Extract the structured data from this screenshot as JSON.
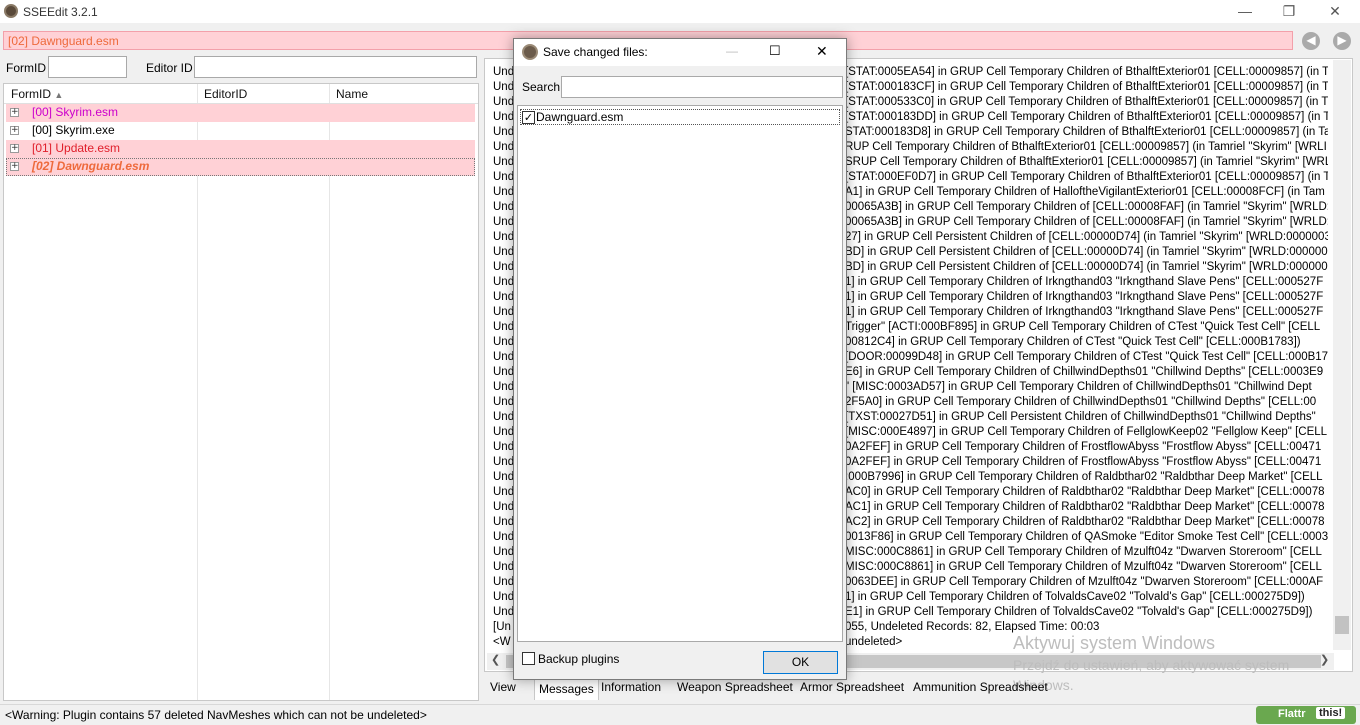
{
  "window": {
    "title": "SSEEdit 3.2.1",
    "min_glyph": "—",
    "max_glyph": "❐",
    "close_glyph": "✕"
  },
  "header": {
    "plugin": "[02] Dawnguard.esm",
    "back_glyph": "◀",
    "forward_glyph": "▶"
  },
  "filter": {
    "formid_label": "FormID",
    "formid_value": "",
    "editorid_label": "Editor ID",
    "editorid_value": ""
  },
  "tree": {
    "columns": [
      "FormID",
      "EditorID",
      "Name"
    ],
    "sort_glyph": "▲",
    "rows": [
      {
        "label": "[00] Skyrim.esm",
        "color": "#cc00cc"
      },
      {
        "label": "[00] Skyrim.exe",
        "color": "#000000"
      },
      {
        "label": "[01] Update.esm",
        "color": "#e0202c"
      },
      {
        "label": "[02] Dawnguard.esm",
        "color": "#ee6a3c"
      }
    ]
  },
  "log": {
    "prefixes": [
      "Und",
      "Und",
      "Und",
      "Und",
      "Und",
      "Und",
      "Und",
      "Und",
      "Und",
      "Und",
      "Und",
      "Und",
      "Und",
      "Und",
      "Und",
      "Und",
      "Und",
      "Und",
      "Und",
      "Und",
      "Und",
      "Und",
      "Und",
      "Und",
      "Und",
      "Und",
      "Und",
      "Und",
      "Und",
      "Und",
      "Und",
      "Und",
      "Und",
      "Und",
      "Und",
      "Und",
      "Und",
      "[Un",
      "<W"
    ],
    "lines": [
      "[STAT:0005EA54] in GRUP Cell Temporary Children of BthalftExterior01 [CELL:00009857] (in T",
      "[STAT:000183CF] in GRUP Cell Temporary Children of BthalftExterior01 [CELL:00009857] (in T",
      "[STAT:000533C0] in GRUP Cell Temporary Children of BthalftExterior01 [CELL:00009857] (in T",
      "[STAT:000183DD] in GRUP Cell Temporary Children of BthalftExterior01 [CELL:00009857] (in Tar",
      "STAT:000183D8] in GRUP Cell Temporary Children of BthalftExterior01 [CELL:00009857] (in Tar",
      "RUP Cell Temporary Children of BthalftExterior01 [CELL:00009857] (in Tamriel \"Skyrim\" [WRLI",
      "SRUP Cell Temporary Children of BthalftExterior01 [CELL:00009857] (in Tamriel \"Skyrim\" [WRL",
      "[STAT:000EF0D7] in GRUP Cell Temporary Children of BthalftExterior01 [CELL:00009857] (in T",
      "A1] in GRUP Cell Temporary Children of HalloftheVigilantExterior01 [CELL:00008FCF] (in Tam",
      "00065A3B] in GRUP Cell Temporary Children of [CELL:00008FAF] (in Tamriel \"Skyrim\" [WRLD:",
      "00065A3B] in GRUP Cell Temporary Children of [CELL:00008FAF] (in Tamriel \"Skyrim\" [WRLD:",
      "27] in GRUP Cell Persistent Children of [CELL:00000D74] (in Tamriel \"Skyrim\" [WRLD:0000003",
      "BD] in GRUP Cell Persistent Children of [CELL:00000D74] (in Tamriel \"Skyrim\" [WRLD:000000",
      "BD] in GRUP Cell Persistent Children of [CELL:00000D74] (in Tamriel \"Skyrim\" [WRLD:000000",
      "1] in GRUP Cell Temporary Children of Irkngthand03 \"Irkngthand Slave Pens\" [CELL:000527F",
      "1] in GRUP Cell Temporary Children of Irkngthand03 \"Irkngthand Slave Pens\" [CELL:000527F",
      "1] in GRUP Cell Temporary Children of Irkngthand03 \"Irkngthand Slave Pens\" [CELL:000527F",
      "Trigger\" [ACTI:000BF895] in GRUP Cell Temporary Children of CTest \"Quick Test Cell\" [CELL",
      "00812C4] in GRUP Cell Temporary Children of CTest \"Quick Test Cell\" [CELL:000B1783])",
      "[DOOR:00099D48] in GRUP Cell Temporary Children of CTest \"Quick Test Cell\" [CELL:000B17",
      "E6] in GRUP Cell Temporary Children of ChillwindDepths01 \"Chillwind Depths\" [CELL:0003E9",
      "\" [MISC:0003AD57] in GRUP Cell Temporary Children of ChillwindDepths01 \"Chillwind Dept",
      "2F5A0] in GRUP Cell Temporary Children of ChillwindDepths01 \"Chillwind Depths\" [CELL:00",
      "[TXST:00027D51] in GRUP Cell Persistent Children of ChillwindDepths01 \"Chillwind Depths\"",
      "[MISC:000E4897] in GRUP Cell Temporary Children of FellglowKeep02 \"Fellglow Keep\" [CELL",
      "0A2FEF] in GRUP Cell Temporary Children of FrostflowAbyss \"Frostflow Abyss\" [CELL:00471",
      "0A2FEF] in GRUP Cell Temporary Children of FrostflowAbyss \"Frostflow Abyss\" [CELL:00471",
      ":000B7996] in GRUP Cell Temporary Children of Raldbthar02 \"Raldbthar Deep Market\" [CELL",
      "AC0] in GRUP Cell Temporary Children of Raldbthar02 \"Raldbthar Deep Market\" [CELL:00078",
      "AC1] in GRUP Cell Temporary Children of Raldbthar02 \"Raldbthar Deep Market\" [CELL:00078",
      "AC2] in GRUP Cell Temporary Children of Raldbthar02 \"Raldbthar Deep Market\" [CELL:00078",
      "0013F86] in GRUP Cell Temporary Children of QASmoke \"Editor Smoke Test Cell\" [CELL:00032",
      "MISC:000C8861] in GRUP Cell Temporary Children of Mzulft04z \"Dwarven Storeroom\" [CELL",
      "MISC:000C8861] in GRUP Cell Temporary Children of Mzulft04z \"Dwarven Storeroom\" [CELL",
      "0063DEE] in GRUP Cell Temporary Children of Mzulft04z \"Dwarven Storeroom\" [CELL:000AF",
      "1] in GRUP Cell Temporary Children of TolvaldsCave02 \"Tolvald's Gap\" [CELL:000275D9])",
      "E1] in GRUP Cell Temporary Children of TolvaldsCave02 \"Tolvald's Gap\" [CELL:000275D9])",
      "055, Undeleted Records: 82, Elapsed Time: 00:03",
      "undeleted>"
    ],
    "scroll_left_glyph": "❮",
    "scroll_right_glyph": "❯"
  },
  "tabs": [
    "View",
    "Messages",
    "Information",
    "Weapon Spreadsheet",
    "Armor Spreadsheet",
    "Ammunition Spreadsheet"
  ],
  "status": {
    "message": "<Warning: Plugin contains 57 deleted NavMeshes which can not be undeleted>",
    "flattr": "Flattr",
    "flattr_this": "this!"
  },
  "watermark": {
    "line1": "Aktywuj system Windows",
    "line2": "Przejdź do ustawień, aby aktywować system",
    "line3": "Windows."
  },
  "dialog": {
    "title": "Save changed files:",
    "min_glyph": "—",
    "max_glyph": "☐",
    "close_glyph": "✕",
    "search_label": "Search",
    "search_value": "",
    "files": [
      {
        "name": "Dawnguard.esm",
        "checked": true
      }
    ],
    "backup_label": "Backup plugins",
    "backup_checked": false,
    "ok_label": "OK",
    "check_glyph": "✓"
  },
  "colors": {
    "highlight_bg": "#ffd1d6",
    "accent": "#0078d7"
  }
}
